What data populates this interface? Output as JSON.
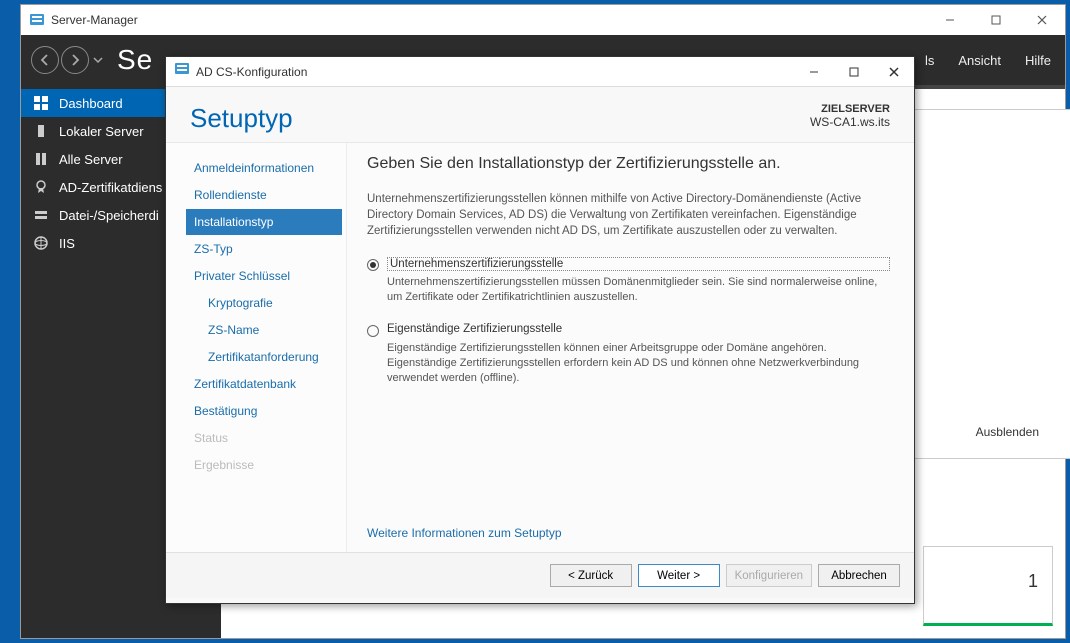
{
  "outer": {
    "title": "Server-Manager",
    "toolbar_text": "Se",
    "menu": {
      "ls": "ls",
      "ansicht": "Ansicht",
      "hilfe": "Hilfe"
    }
  },
  "sidebar": {
    "items": [
      {
        "label": "Dashboard",
        "icon": "dashboard"
      },
      {
        "label": "Lokaler Server",
        "icon": "localserver"
      },
      {
        "label": "Alle Server",
        "icon": "allservers"
      },
      {
        "label": "AD-Zertifikatdiens",
        "icon": "cert"
      },
      {
        "label": "Datei-/Speicherdi",
        "icon": "storage"
      },
      {
        "label": "IIS",
        "icon": "iis"
      }
    ]
  },
  "content": {
    "ausblenden": "Ausblenden",
    "tile_value": "1"
  },
  "dialog": {
    "title": "AD CS-Konfiguration",
    "heading": "Setuptyp",
    "target_label": "ZIELSERVER",
    "target_server": "WS-CA1.ws.its",
    "nav": [
      {
        "label": "Anmeldeinformationen"
      },
      {
        "label": "Rollendienste"
      },
      {
        "label": "Installationstyp",
        "selected": true
      },
      {
        "label": "ZS-Typ"
      },
      {
        "label": "Privater Schlüssel"
      },
      {
        "label": "Kryptografie",
        "sub": true
      },
      {
        "label": "ZS-Name",
        "sub": true
      },
      {
        "label": "Zertifikatanforderung",
        "sub": true
      },
      {
        "label": "Zertifikatdatenbank"
      },
      {
        "label": "Bestätigung"
      },
      {
        "label": "Status",
        "disabled": true
      },
      {
        "label": "Ergebnisse",
        "disabled": true
      }
    ],
    "main": {
      "subtitle": "Geben Sie den Installationstyp der Zertifizierungsstelle an.",
      "description": "Unternehmenszertifizierungsstellen können mithilfe von Active Directory-Domänendienste (Active Directory Domain Services, AD DS) die Verwaltung von Zertifikaten vereinfachen. Eigenständige Zertifizierungsstellen verwenden nicht AD DS, um Zertifikate auszustellen oder zu verwalten.",
      "opt1_label": "Unternehmenszertifizierungsstelle",
      "opt1_expl": "Unternehmenszertifizierungsstellen müssen Domänenmitglieder sein. Sie sind normalerweise online, um Zertifikate oder Zertifikatrichtlinien auszustellen.",
      "opt2_label": "Eigenständige Zertifizierungsstelle",
      "opt2_expl": "Eigenständige Zertifizierungsstellen können einer Arbeitsgruppe oder Domäne angehören. Eigenständige Zertifizierungsstellen erfordern kein AD DS und können ohne Netzwerkverbindung verwendet werden (offline).",
      "more_info": "Weitere Informationen zum Setuptyp"
    },
    "buttons": {
      "back": "< Zurück",
      "next": "Weiter >",
      "configure": "Konfigurieren",
      "cancel": "Abbrechen"
    }
  }
}
